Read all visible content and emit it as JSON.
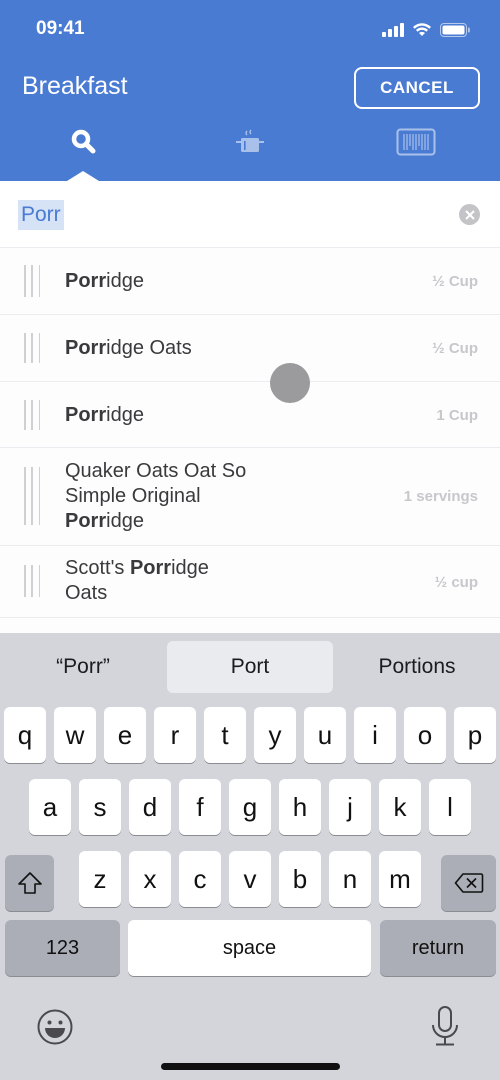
{
  "status_bar": {
    "time": "09:41",
    "icons": [
      "signal-icon",
      "wifi-icon",
      "battery-icon"
    ]
  },
  "header": {
    "title": "Breakfast",
    "cancel_label": "CANCEL",
    "background": "#4a7bd2"
  },
  "tabs": [
    {
      "name": "search",
      "icon": "search-icon",
      "active": true
    },
    {
      "name": "recipes",
      "icon": "cooking-pot-icon",
      "active": false
    },
    {
      "name": "barcode",
      "icon": "barcode-icon",
      "active": false
    }
  ],
  "search": {
    "value": "Porr"
  },
  "results": [
    {
      "match": "Porr",
      "pre": "",
      "post": "idge",
      "serving": "½ Cup"
    },
    {
      "match": "Porr",
      "pre": "",
      "post": "idge Oats",
      "serving": "½ Cup"
    },
    {
      "match": "Porr",
      "pre": "",
      "post": "idge",
      "serving": "1 Cup"
    },
    {
      "match": "Porr",
      "pre": "Quaker Oats Oat So Simple Original ",
      "post": "idge",
      "serving": "1 servings"
    },
    {
      "match": "Porr",
      "pre": "Scott's ",
      "post": "idge Oats",
      "serving": "½ cup"
    }
  ],
  "keyboard": {
    "suggestions": [
      "“Porr”",
      "Port",
      "Portions"
    ],
    "row1": [
      "q",
      "w",
      "e",
      "r",
      "t",
      "y",
      "u",
      "i",
      "o",
      "p"
    ],
    "row2": [
      "a",
      "s",
      "d",
      "f",
      "g",
      "h",
      "j",
      "k",
      "l"
    ],
    "row3": [
      "z",
      "x",
      "c",
      "v",
      "b",
      "n",
      "m"
    ],
    "numbers_label": "123",
    "space_label": "space",
    "return_label": "return"
  }
}
